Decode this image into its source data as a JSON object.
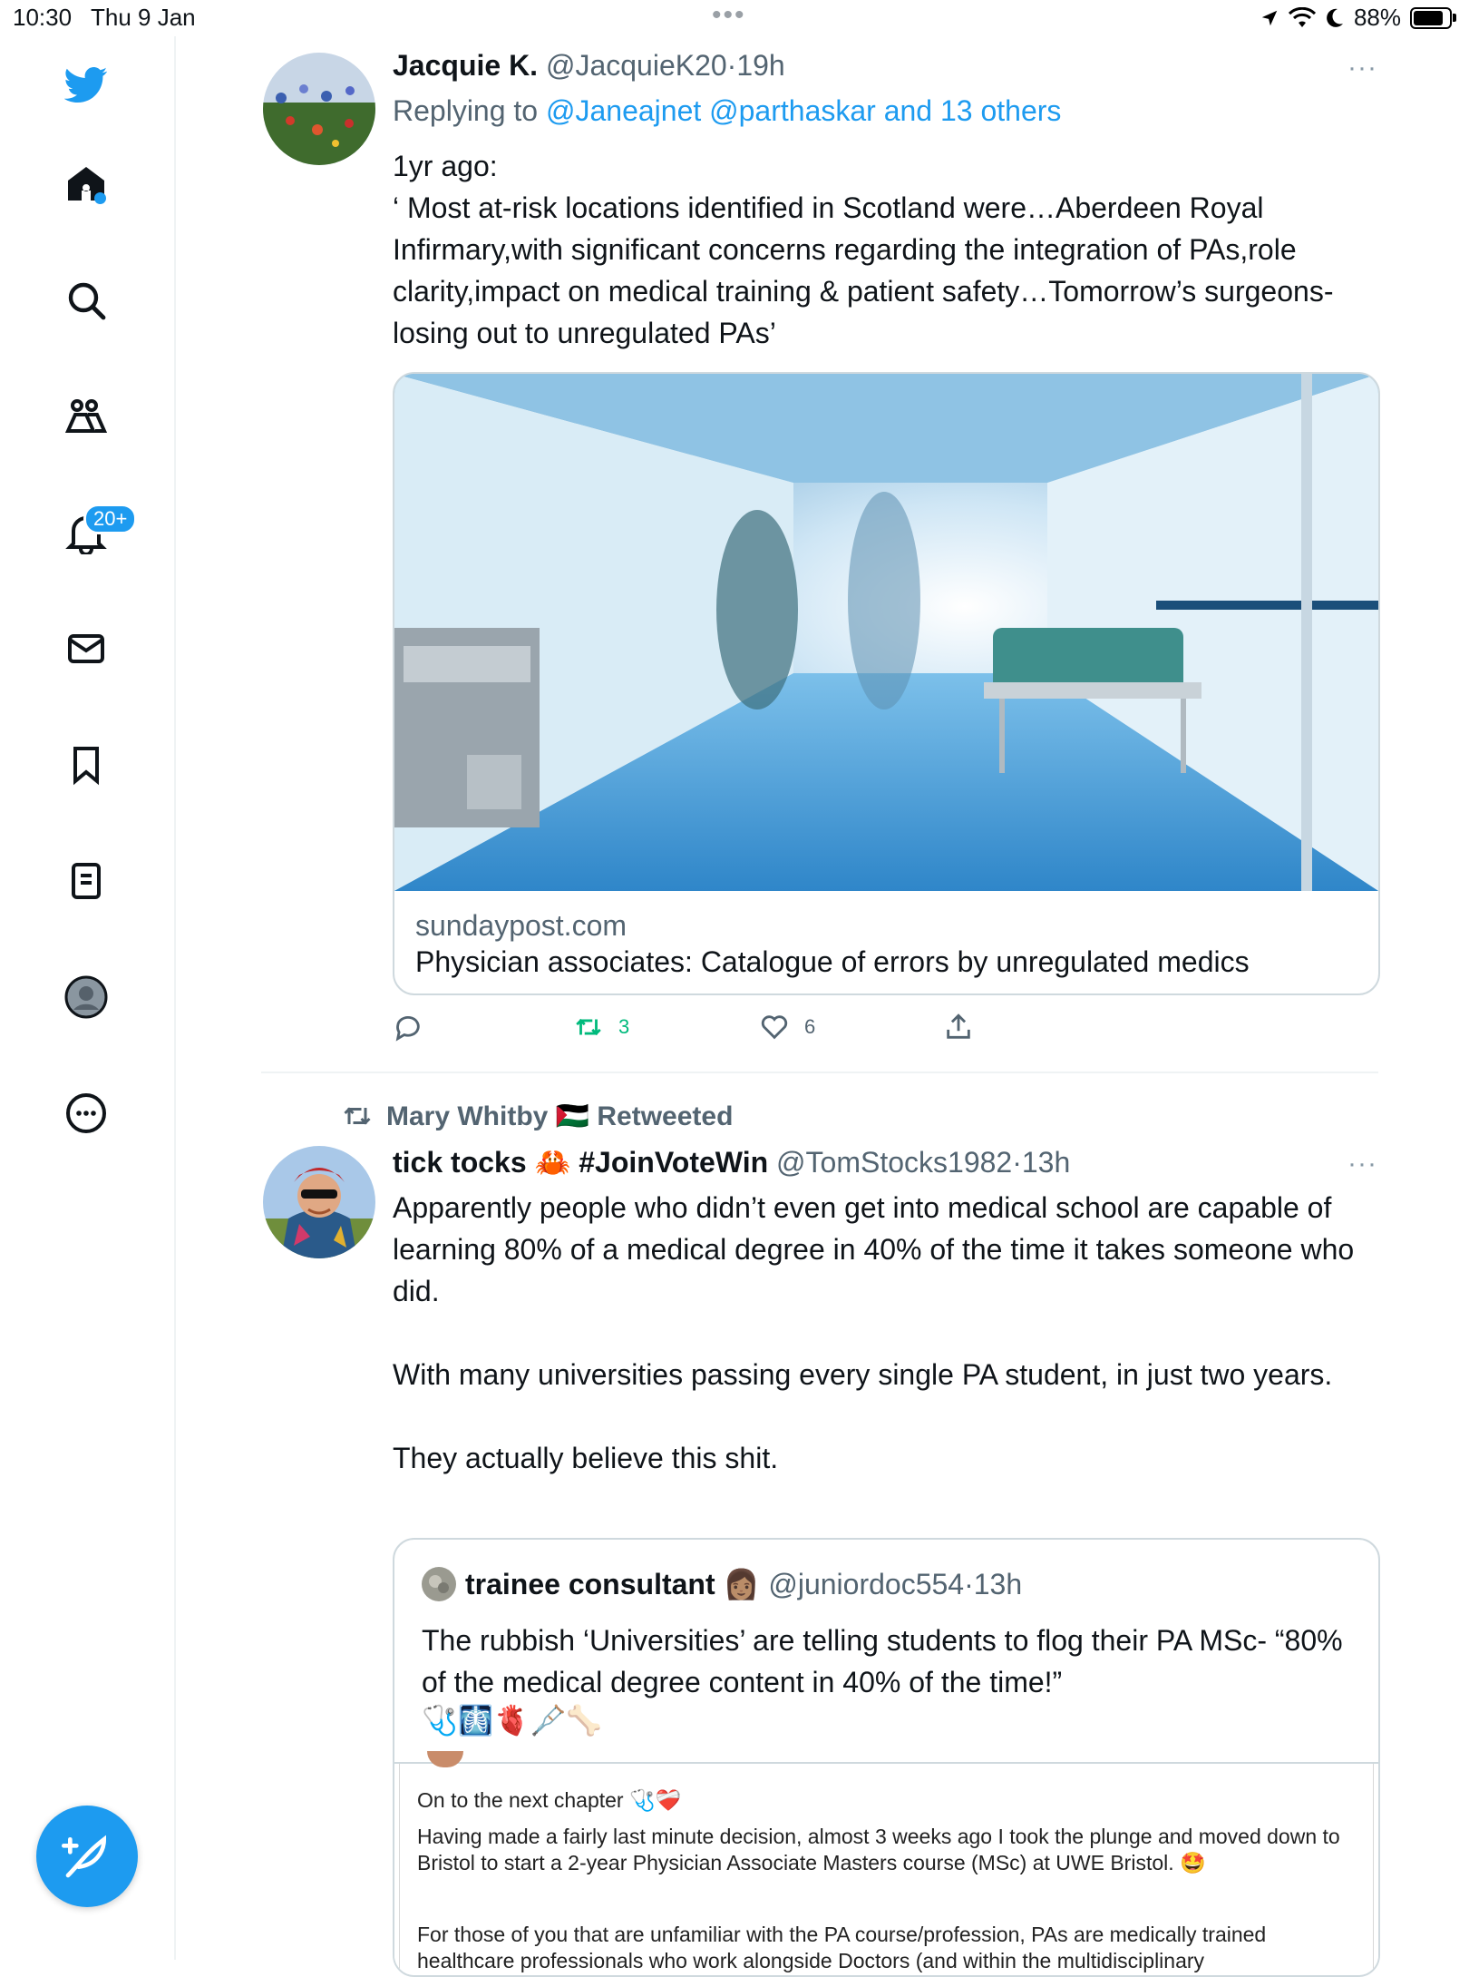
{
  "status_bar": {
    "time": "10:30",
    "date": "Thu 9 Jan",
    "battery": "88%",
    "battery_level": 0.88
  },
  "sidebar": {
    "items": [
      {
        "name": "twitter-logo"
      },
      {
        "name": "home"
      },
      {
        "name": "search"
      },
      {
        "name": "communities"
      },
      {
        "name": "notifications"
      },
      {
        "name": "messages"
      },
      {
        "name": "bookmarks"
      },
      {
        "name": "lists"
      },
      {
        "name": "profile"
      },
      {
        "name": "more"
      }
    ],
    "notifications_badge": "20+",
    "accent": "#1d9bf0"
  },
  "tweet1": {
    "name": "Jacquie K.",
    "handle": "@JacquieK20",
    "sep": "·",
    "time": "19h",
    "more": "···",
    "replying_prefix": "Replying to ",
    "replying_to": "@Janeajnet @parthaskar",
    "replying_and": " and ",
    "replying_others": "13 others",
    "text": "1yr ago:\n‘ Most at-risk locations identified in Scotland were…Aberdeen Royal Infirmary,with significant concerns regarding the integration of PAs,role clarity,impact on medical training & patient safety…Tomorrow’s surgeons-losing out to unregulated PAs’",
    "card": {
      "domain": "sundaypost.com",
      "title": "Physician associates: Catalogue of errors by unregulated medics"
    },
    "retweets": "3",
    "likes": "6"
  },
  "tweet2": {
    "retweeted_by": "Mary Whitby 🇵🇸 Retweeted",
    "name": "tick tocks 🦀 #JoinVoteWin",
    "handle": "@TomStocks1982",
    "sep": "·",
    "time": "13h",
    "more": "···",
    "text": "Apparently people who didn’t even get into medical school are capable of learning 80% of a medical degree in 40% of the time it takes someone who did.\n\nWith many universities passing every single PA student, in just two years.\n\nThey actually believe this shit.",
    "quote": {
      "name": "trainee consultant 👩🏽",
      "handle": "@juniordoc554",
      "sep": "·",
      "time": "13h",
      "text": "The rubbish ‘Universities’ are telling students to flog their PA MSc- “80% of the medical degree content in 40% of the time!”",
      "emojis": "🩺🩻🫀🩼🦴",
      "screenshot": {
        "p1": "On to the next chapter 🩺❤️‍🩹",
        "p2": "Having made a fairly last minute decision, almost 3 weeks ago I took the plunge and moved down to Bristol to start a 2-year Physician Associate Masters course (MSc) at UWE Bristol. 🤩",
        "p3": "For those of you that are unfamiliar with the PA course/profession, PAs are medically trained healthcare professionals who work alongside Doctors (and within the multidisciplinary"
      }
    }
  }
}
